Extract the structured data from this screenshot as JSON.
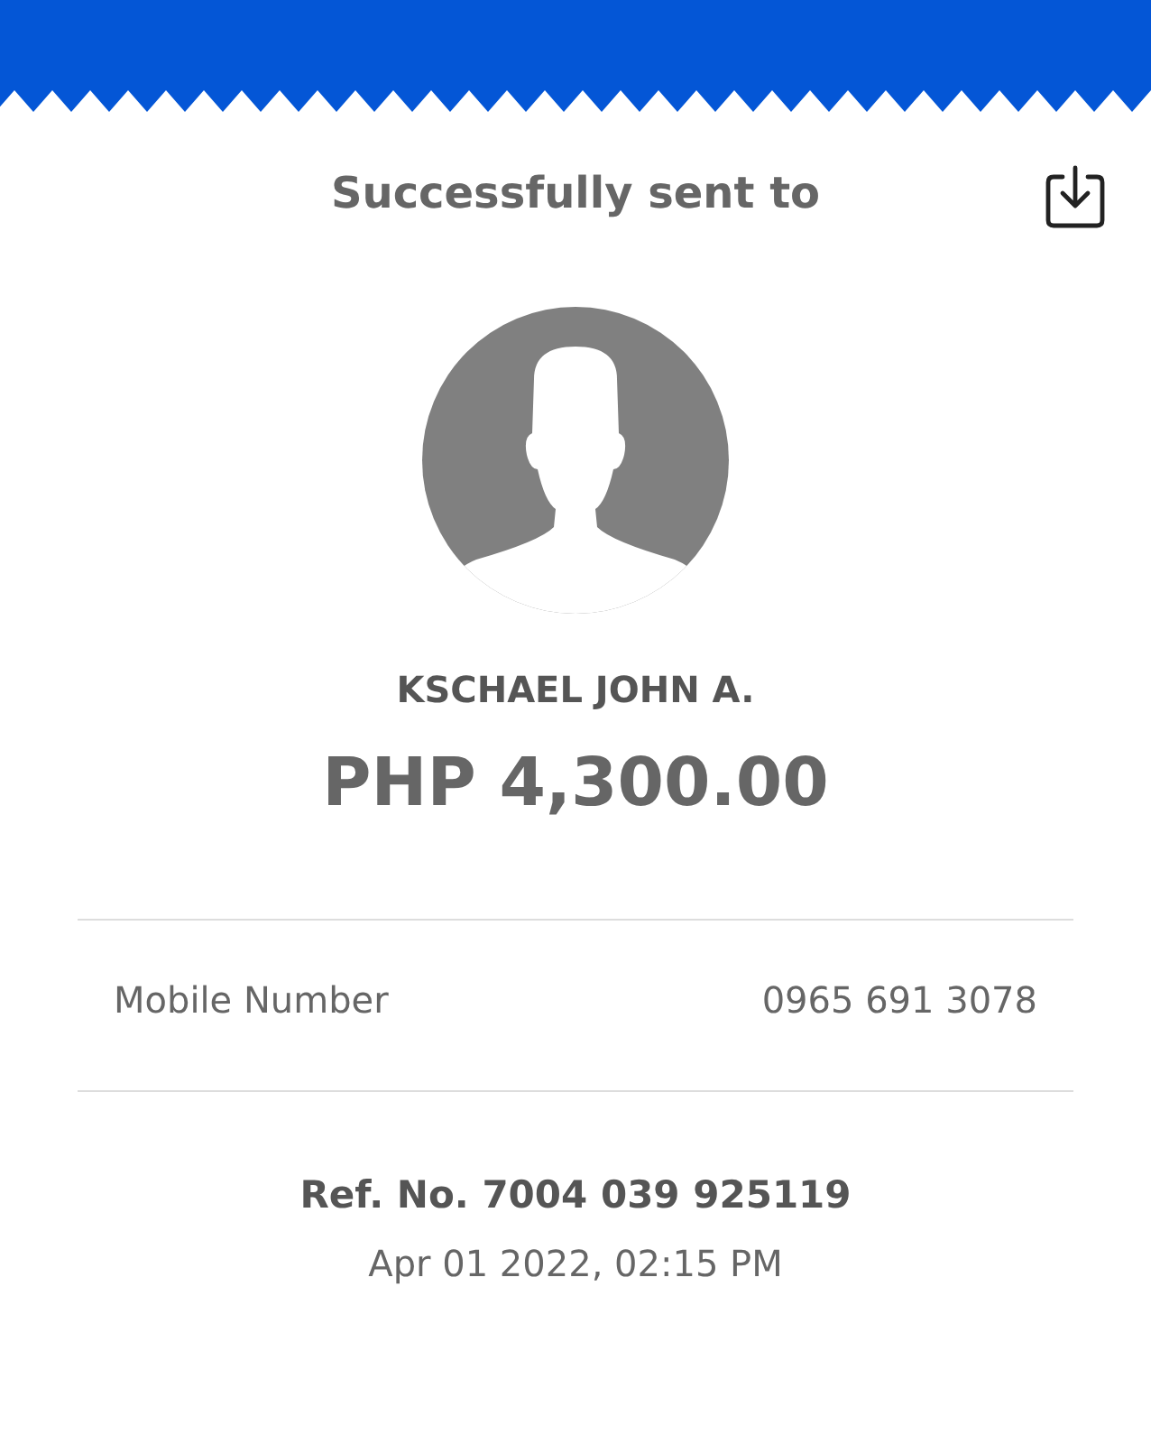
{
  "header": {
    "title": "Successfully sent to"
  },
  "recipient": {
    "name": "KSCHAEL JOHN A.",
    "amount": "PHP 4,300.00"
  },
  "details": [
    {
      "label": "Mobile Number",
      "value": "0965 691 3078"
    }
  ],
  "reference": {
    "number": "Ref. No. 7004 039 925119",
    "datetime": "Apr 01 2022, 02:15 PM"
  }
}
